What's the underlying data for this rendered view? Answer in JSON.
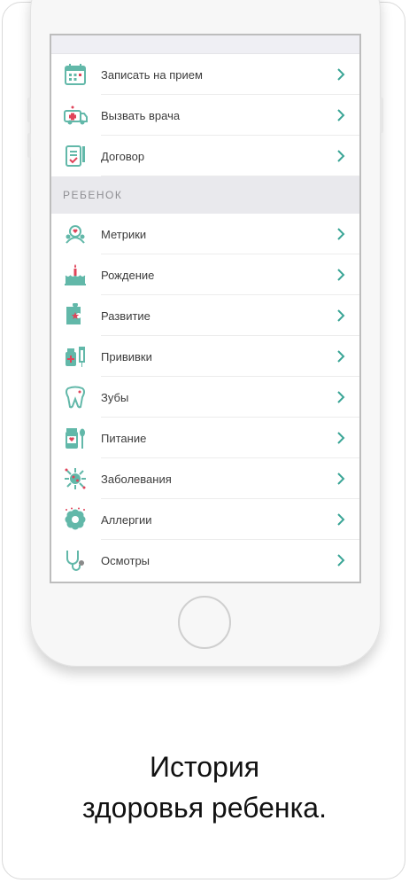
{
  "menu_top": [
    {
      "label": "Записать на прием",
      "icon": "calendar-icon"
    },
    {
      "label": "Вызвать врача",
      "icon": "ambulance-icon"
    },
    {
      "label": "Договор",
      "icon": "contract-icon"
    }
  ],
  "section_child": {
    "title": "РЕБЕНОК",
    "items": [
      {
        "label": "Метрики",
        "icon": "metrics-icon"
      },
      {
        "label": "Рождение",
        "icon": "birthday-cake-icon"
      },
      {
        "label": "Развитие",
        "icon": "puzzle-icon"
      },
      {
        "label": "Прививки",
        "icon": "vaccine-icon"
      },
      {
        "label": "Зубы",
        "icon": "tooth-icon"
      },
      {
        "label": "Питание",
        "icon": "baby-food-icon"
      },
      {
        "label": "Заболевания",
        "icon": "virus-icon"
      },
      {
        "label": "Аллергии",
        "icon": "allergy-flower-icon"
      },
      {
        "label": "Осмотры",
        "icon": "stethoscope-icon"
      }
    ]
  },
  "caption": {
    "line1": "История",
    "line2": "здоровья ребенка."
  },
  "colors": {
    "teal": "#62b8a9",
    "red": "#e0445a",
    "chevron": "#3aa596"
  }
}
